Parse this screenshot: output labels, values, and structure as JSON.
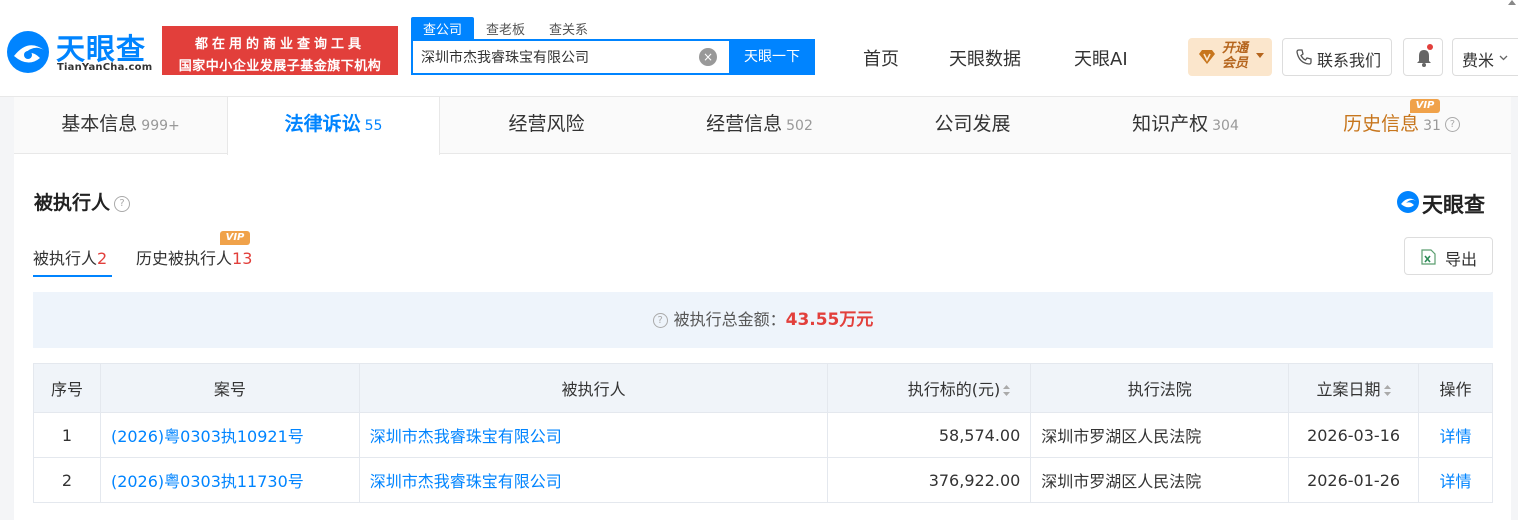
{
  "header": {
    "logo_text": "天眼查",
    "logo_sub": "TianYanCha.com",
    "slogan_line1": "都在用的商业查询工具",
    "slogan_line2": "国家中小企业发展子基金旗下机构",
    "search_tabs": [
      "查公司",
      "查老板",
      "查关系"
    ],
    "search_value": "深圳市杰我睿珠宝有限公司",
    "search_button": "天眼一下",
    "nav": [
      "首页",
      "天眼数据",
      "天眼AI"
    ],
    "vip_line1": "开通",
    "vip_line2": "会员",
    "contact": "联系我们",
    "user": "费米"
  },
  "tabs": [
    {
      "label": "基本信息",
      "count": "999+"
    },
    {
      "label": "法律诉讼",
      "count": "55"
    },
    {
      "label": "经营风险",
      "count": ""
    },
    {
      "label": "经营信息",
      "count": "502"
    },
    {
      "label": "公司发展",
      "count": ""
    },
    {
      "label": "知识产权",
      "count": "304"
    },
    {
      "label": "历史信息",
      "count": "31"
    }
  ],
  "vip_tag": "VIP",
  "section": {
    "title": "被执行人",
    "brand": "天眼查",
    "subtabs": [
      {
        "label": "被执行人",
        "count": "2"
      },
      {
        "label": "历史被执行人",
        "count": "13"
      }
    ],
    "export": "导出",
    "summary_label": "被执行总金额：",
    "summary_amount": "43.55万元"
  },
  "table": {
    "headers": [
      "序号",
      "案号",
      "被执行人",
      "执行标的(元)",
      "执行法院",
      "立案日期",
      "操作"
    ],
    "rows": [
      {
        "no": "1",
        "case": "(2026)粤0303执10921号",
        "party": "深圳市杰我睿珠宝有限公司",
        "amount": "58,574.00",
        "court": "深圳市罗湖区人民法院",
        "date": "2026-03-16",
        "action": "详情"
      },
      {
        "no": "2",
        "case": "(2026)粤0303执11730号",
        "party": "深圳市杰我睿珠宝有限公司",
        "amount": "376,922.00",
        "court": "深圳市罗湖区人民法院",
        "date": "2026-01-26",
        "action": "详情"
      }
    ]
  }
}
